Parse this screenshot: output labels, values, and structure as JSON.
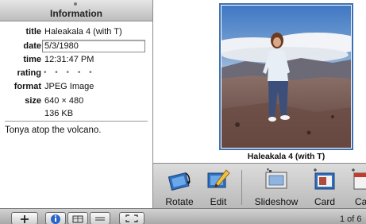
{
  "info_panel": {
    "header": "Information",
    "fields": {
      "title_label": "title",
      "title_value": "Haleakala 4 (with T)",
      "date_label": "date",
      "date_value": "5/3/1980",
      "time_label": "time",
      "time_value": "12:31:47 PM",
      "rating_label": "rating",
      "rating_value": "• • • • •",
      "format_label": "format",
      "format_value": "JPEG Image",
      "size_label": "size",
      "size_dimensions": "640 × 480",
      "size_bytes": "136 KB"
    },
    "comment": "Tonya atop the volcano."
  },
  "viewer": {
    "photo_caption": "Haleakala 4 (with T)",
    "frame_color": "#3d6fb0"
  },
  "toolbar": {
    "rotate_label": "Rotate",
    "edit_label": "Edit",
    "slideshow_label": "Slideshow",
    "card_label": "Card",
    "calendar_label": "Cal"
  },
  "bottom_bar": {
    "page_count": "1 of 6"
  },
  "icons": {
    "rotate": "rotate-icon",
    "edit": "pencil-icon",
    "slideshow": "slideshow-icon",
    "card": "card-icon",
    "calendar": "calendar-icon",
    "add": "plus-icon",
    "info": "info-icon",
    "fullscreen": "fullscreen-icon"
  }
}
